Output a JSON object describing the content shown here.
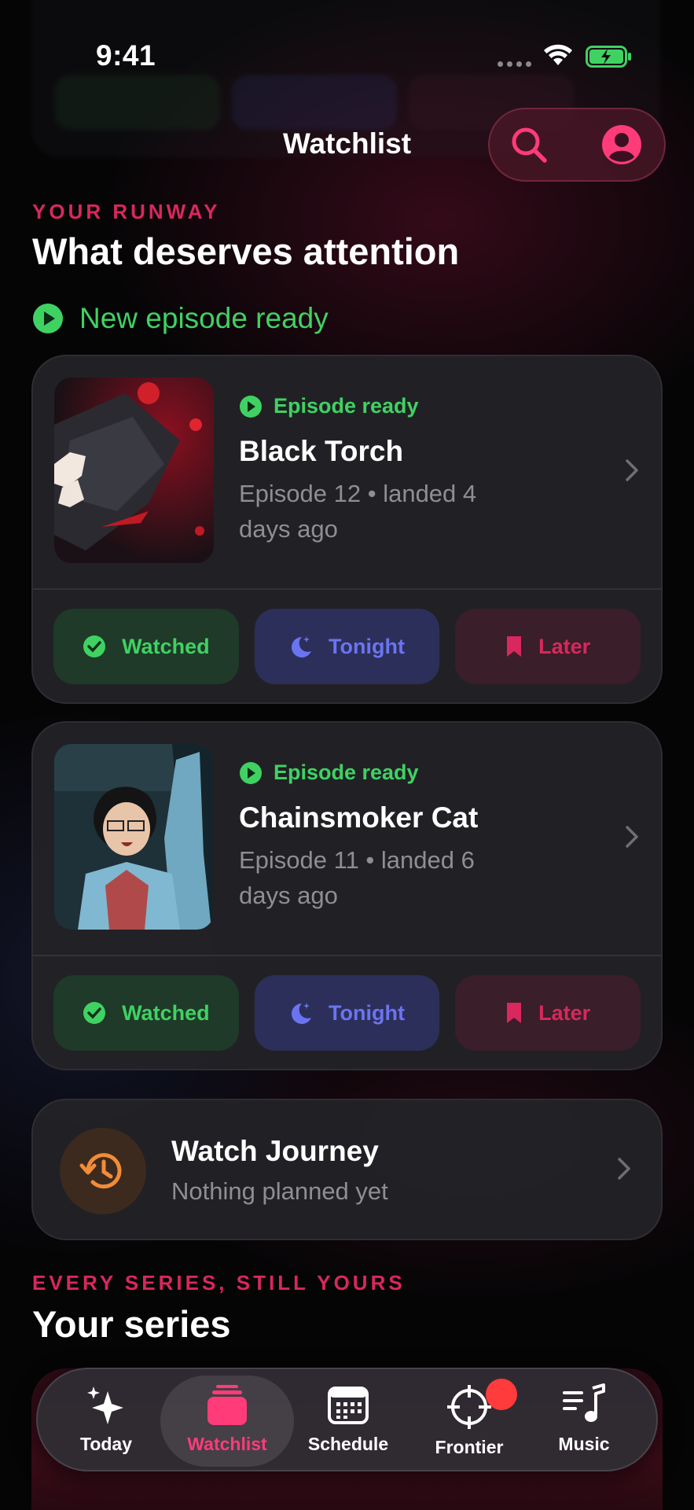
{
  "status_bar": {
    "time": "9:41"
  },
  "nav": {
    "title": "Watchlist",
    "search_icon": "search-icon",
    "profile_icon": "person-circle-icon"
  },
  "runway": {
    "eyebrow": "YOUR RUNWAY",
    "heading": "What deserves attention",
    "ready_label": "New episode ready"
  },
  "cards": [
    {
      "status": "Episode ready",
      "title": "Black Torch",
      "meta": "Episode 12 • landed 4 days ago",
      "actions": {
        "watched": "Watched",
        "tonight": "Tonight",
        "later": "Later"
      }
    },
    {
      "status": "Episode ready",
      "title": "Chainsmoker Cat",
      "meta": "Episode 11 • landed 6 days ago",
      "actions": {
        "watched": "Watched",
        "tonight": "Tonight",
        "later": "Later"
      }
    }
  ],
  "journey": {
    "title": "Watch Journey",
    "subtitle": "Nothing planned yet"
  },
  "series": {
    "eyebrow": "EVERY SERIES, STILL YOURS",
    "heading": "Your series"
  },
  "tabs": [
    {
      "label": "Today",
      "icon": "sparkles-icon"
    },
    {
      "label": "Watchlist",
      "icon": "stack-icon",
      "active": true
    },
    {
      "label": "Schedule",
      "icon": "calendar-icon"
    },
    {
      "label": "Frontier",
      "icon": "crosshair-icon",
      "badge": true
    },
    {
      "label": "Music",
      "icon": "music-list-icon"
    }
  ],
  "colors": {
    "accent": "#d8285d",
    "green": "#3fd263",
    "indigo": "#6b74f0",
    "orange": "#f28c38"
  }
}
